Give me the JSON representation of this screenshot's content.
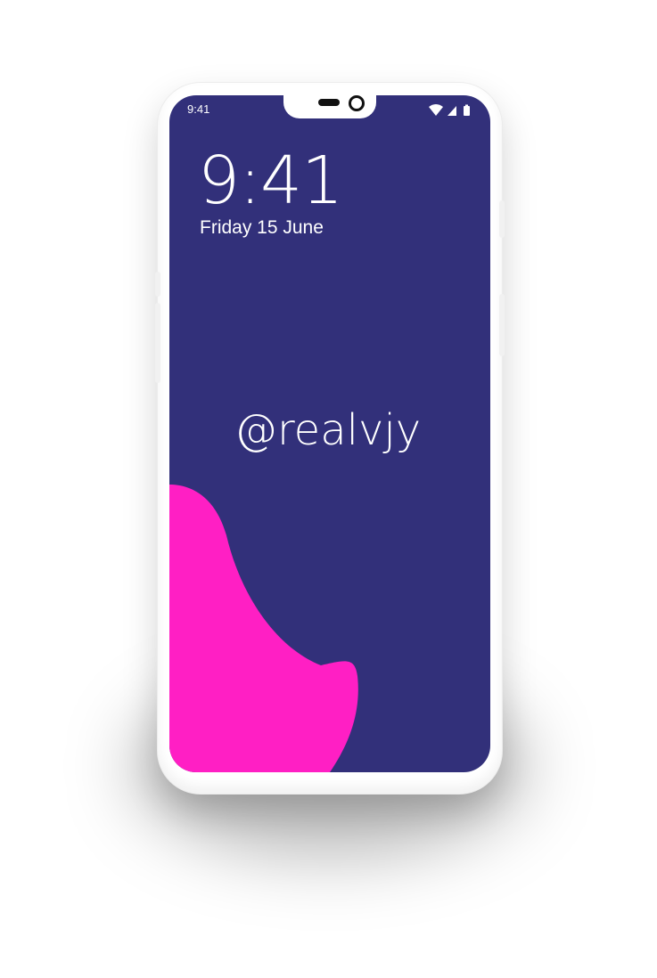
{
  "status_bar": {
    "time": "9:41",
    "icons": [
      "wifi-icon",
      "signal-icon",
      "battery-icon"
    ]
  },
  "lock_screen": {
    "clock": "9:41",
    "date": "Friday 15 June",
    "handle": "@realvjy"
  },
  "colors": {
    "wallpaper": "#32307a",
    "blob": "#ff1fc4",
    "frame": "#ffffff"
  }
}
